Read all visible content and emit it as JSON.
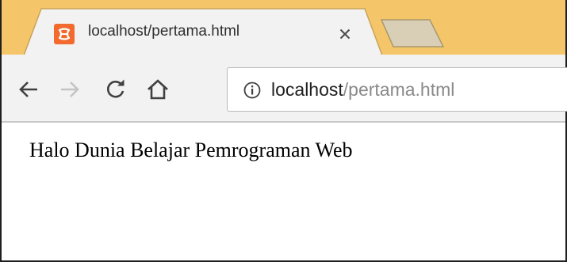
{
  "tab": {
    "title": "localhost/pertama.html",
    "favicon": "xampp-icon",
    "close_icon": "close-icon"
  },
  "toolbar": {
    "back_icon": "back-arrow-icon",
    "forward_icon": "forward-arrow-icon",
    "reload_icon": "reload-icon",
    "home_icon": "home-icon"
  },
  "address_bar": {
    "info_icon": "info-icon",
    "host": "localhost",
    "path": "/pertama.html"
  },
  "page": {
    "text": "Halo Dunia Belajar Pemrograman Web"
  },
  "colors": {
    "tabstrip": "#f5c56a",
    "favicon": "#f26a2d",
    "toolbar": "#f2f2f2"
  }
}
